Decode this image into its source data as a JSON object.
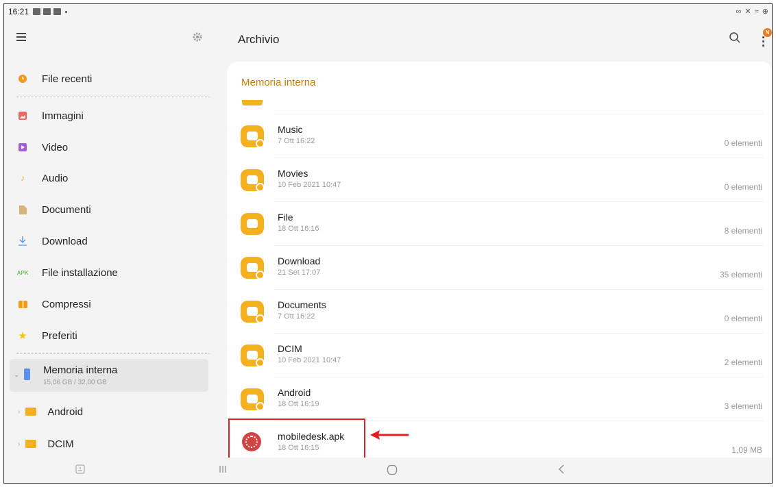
{
  "status_bar": {
    "time": "16:21",
    "right_icons": "∞ ✕ ≈ ⊕"
  },
  "sidebar": {
    "items": [
      {
        "label": "File recenti",
        "icon": "clock-icon",
        "color": "#f29a1c"
      },
      {
        "label": "Immagini",
        "icon": "image-icon",
        "color": "#f06464"
      },
      {
        "label": "Video",
        "icon": "video-icon",
        "color": "#a35ddc"
      },
      {
        "label": "Audio",
        "icon": "music-icon",
        "color": "#f4b01f"
      },
      {
        "label": "Documenti",
        "icon": "document-icon",
        "color": "#d9b37a"
      },
      {
        "label": "Download",
        "icon": "download-icon",
        "color": "#4d8ef0"
      },
      {
        "label": "File installazione",
        "icon": "apk-icon",
        "icon_text": "APK",
        "color": "#74c05a"
      },
      {
        "label": "Compressi",
        "icon": "archive-icon",
        "color": "#f29a1c"
      },
      {
        "label": "Preferiti",
        "icon": "star-icon",
        "color": "#f5c518"
      }
    ],
    "storage": {
      "label": "Memoria interna",
      "usage": "15,06 GB / 32,00 GB"
    },
    "tree": [
      {
        "label": "Android"
      },
      {
        "label": "DCIM"
      }
    ]
  },
  "main": {
    "title": "Archivio",
    "badge": "N",
    "section_title": "Memoria interna",
    "files": [
      {
        "name": "Music",
        "date": "7 Ott 16:22",
        "count": "0 elementi",
        "sub_icon": "music-note-icon"
      },
      {
        "name": "Movies",
        "date": "10 Feb 2021 10:47",
        "count": "0 elementi",
        "sub_icon": "play-icon"
      },
      {
        "name": "File",
        "date": "18 Ott 16:16",
        "count": "8 elementi",
        "sub_icon": ""
      },
      {
        "name": "Download",
        "date": "21 Set 17:07",
        "count": "35 elementi",
        "sub_icon": "download-icon"
      },
      {
        "name": "Documents",
        "date": "7 Ott 16:22",
        "count": "0 elementi",
        "sub_icon": "document-icon"
      },
      {
        "name": "DCIM",
        "date": "10 Feb 2021 10:47",
        "count": "2 elementi",
        "sub_icon": "camera-icon"
      },
      {
        "name": "Android",
        "date": "18 Ott 16:19",
        "count": "3 elementi",
        "sub_icon": "gear-icon"
      },
      {
        "name": "mobiledesk.apk",
        "date": "18 Ott 16:15",
        "count": "1,09 MB",
        "sub_icon": "apk-app-icon"
      }
    ]
  },
  "colors": {
    "accent": "#c77d00",
    "folder": "#f4b01f",
    "annotation": "#e02020"
  }
}
